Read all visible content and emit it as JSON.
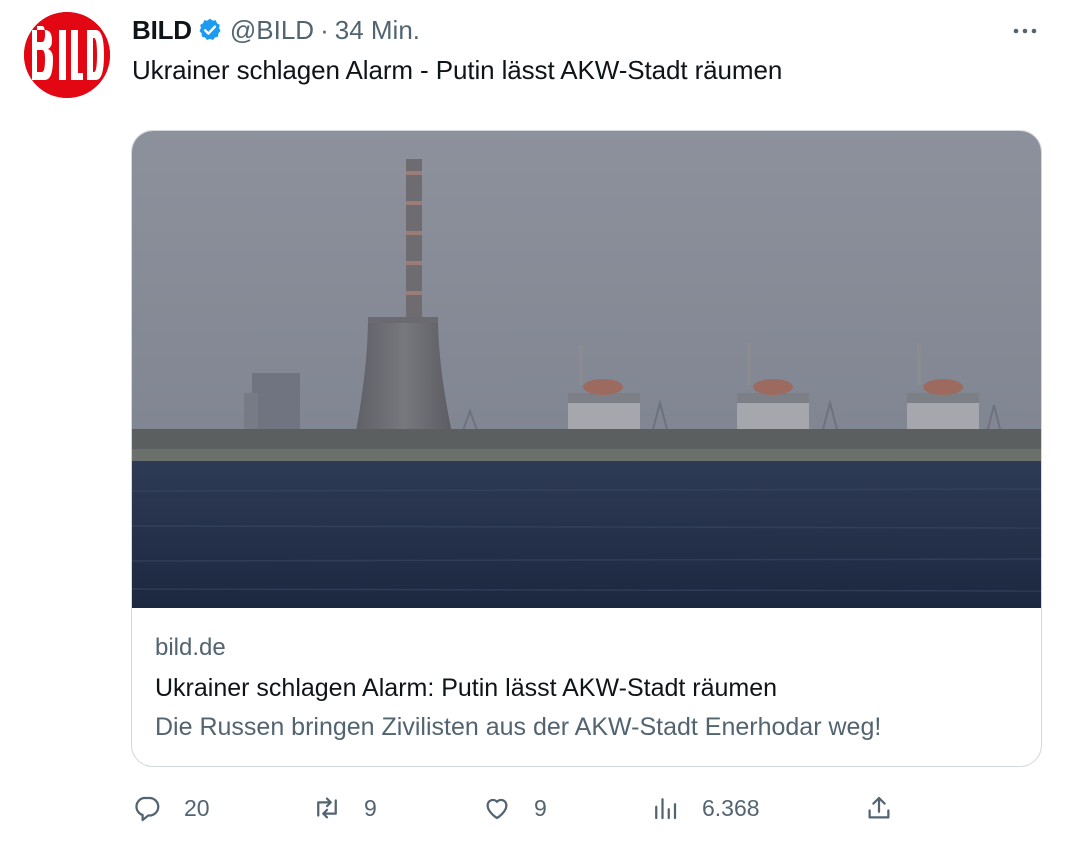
{
  "account": {
    "logo_text": "Bild",
    "name": "BILD",
    "handle": "@BILD",
    "separator": "·",
    "time": "34 Min."
  },
  "tweet": {
    "text": "Ukrainer schlagen Alarm - Putin lässt AKW-Stadt räumen"
  },
  "card": {
    "domain": "bild.de",
    "title": "Ukrainer schlagen Alarm: Putin lässt AKW-Stadt räumen",
    "description": "Die Russen bringen Zivilisten aus der AKW-Stadt Enerhodar weg!",
    "image_subject": "nuclear-power-plant-across-water"
  },
  "actions": {
    "replies": "20",
    "retweets": "9",
    "likes": "9",
    "views": "6.368"
  },
  "icons": {
    "verified": "verified-badge-icon",
    "more": "more-options-icon",
    "reply": "reply-icon",
    "retweet": "retweet-icon",
    "like": "like-icon",
    "views": "views-icon",
    "share": "share-icon"
  },
  "colors": {
    "brand_red": "#e30613",
    "verified_blue": "#1d9bf0",
    "secondary_text": "#536471",
    "border": "#cfd9de"
  }
}
